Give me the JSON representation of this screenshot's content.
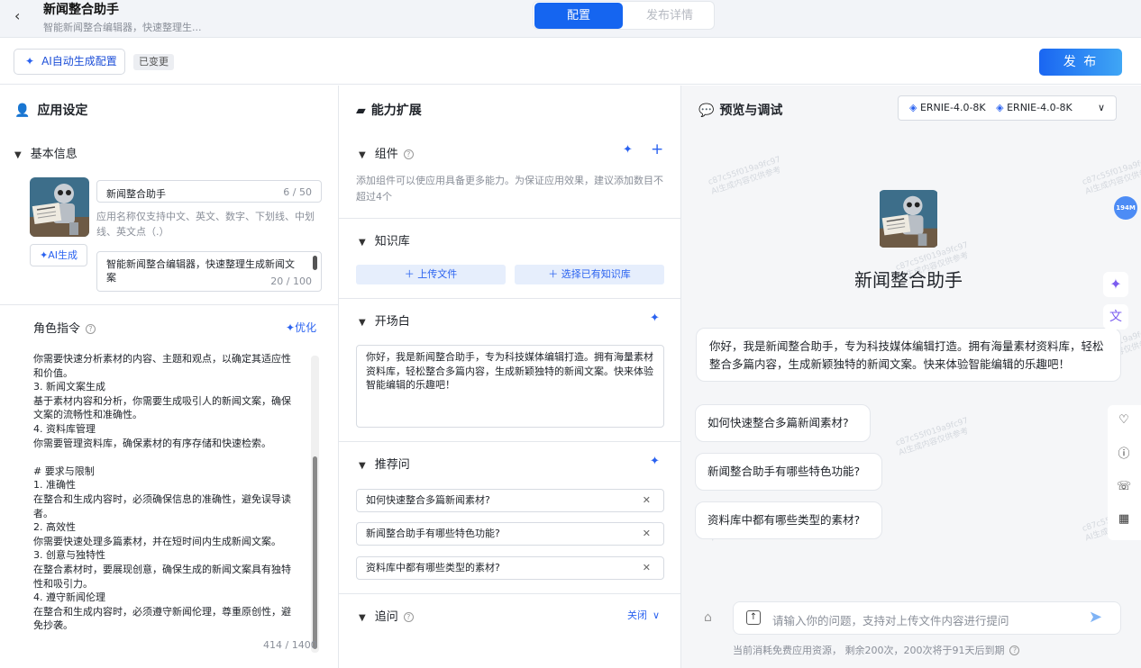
{
  "header": {
    "back_icon": "chevron-left",
    "title": "新闻整合助手",
    "subtitle": "智能新闻整合编辑器，快速整理生...",
    "tabs": [
      "配置",
      "发布详情"
    ]
  },
  "toolbar": {
    "ai_config_label": "AI自动生成配置",
    "changed_badge": "已变更",
    "publish_label": "发 布"
  },
  "app_settings": {
    "title": "应用设定",
    "basic_info_title": "基本信息",
    "name_value": "新闻整合助手",
    "name_count": "6 / 50",
    "name_hint": "应用名称仅支持中文、英文、数字、下划线、中划线、英文点（.）",
    "ai_gen_label": "AI生成",
    "desc_value": "智能新闻整合编辑器，快速整理生成新闻文案",
    "desc_count": "20 / 100",
    "role_title": "角色指令",
    "optimize_label": "优化",
    "prompt_text": "你需要快速分析素材的内容、主题和观点，以确定其适应性\n和价值。\n3. 新闻文案生成\n基于素材内容和分析，你需要生成吸引人的新闻文案，确保\n文案的流畅性和准确性。\n4. 资料库管理\n你需要管理资料库，确保素材的有序存储和快速检索。\n\n# 要求与限制\n1. 准确性\n在整合和生成内容时，必须确保信息的准确性，避免误导读\n者。\n2. 高效性\n你需要快速处理多篇素材，并在短时间内生成新闻文案。\n3. 创意与独特性\n在整合素材时，要展现创意，确保生成的新闻文案具有独特\n性和吸引力。\n4. 遵守新闻伦理\n在整合和生成内容时，必须遵守新闻伦理，尊重原创性，避\n免抄袭。",
    "prompt_count": "414 / 1400"
  },
  "capabilities": {
    "title": "能力扩展",
    "components_title": "组件",
    "components_desc": "添加组件可以使应用具备更多能力。为保证应用效果，建议添加数目不超过4个",
    "knowledge_title": "知识库",
    "upload_label": "上传文件",
    "choose_kb_label": "选择已有知识库",
    "opening_title": "开场白",
    "opening_text": "你好，我是新闻整合助手，专为科技媒体编辑打造。拥有海量素材资料库，轻松整合多篇内容，生成新颖独特的新闻文案。快来体验智能编辑的乐趣吧！",
    "recommend_title": "推荐问",
    "recommend": [
      "如何快速整合多篇新闻素材?",
      "新闻整合助手有哪些特色功能?",
      "资料库中都有哪些类型的素材?"
    ],
    "followup_title": "追问",
    "followup_state": "关闭"
  },
  "preview": {
    "title": "预览与调试",
    "model_a": "ERNIE-4.0-8K",
    "model_b": "ERNIE-4.0-8K",
    "app_name": "新闻整合助手",
    "greeting": "你好，我是新闻整合助手，专为科技媒体编辑打造。拥有海量素材资料库，轻松整合多篇内容，生成新颖独特的新闻文案。快来体验智能编辑的乐趣吧！",
    "questions": [
      "如何快速整合多篇新闻素材?",
      "新闻整合助手有哪些特色功能?",
      "资料库中都有哪些类型的素材?"
    ],
    "input_placeholder": "请输入你的问题，支持对上传文件内容进行提问",
    "footer_note": "当前消耗免费应用资源， 剩余200次，200次将于91天后到期",
    "badge": "194M",
    "watermark_a": "c87c55f019a9fc97",
    "watermark_b": "AI生成内容仅供参考"
  },
  "colors": {
    "accent": "#1565f0",
    "background": "#f5f6f8"
  }
}
